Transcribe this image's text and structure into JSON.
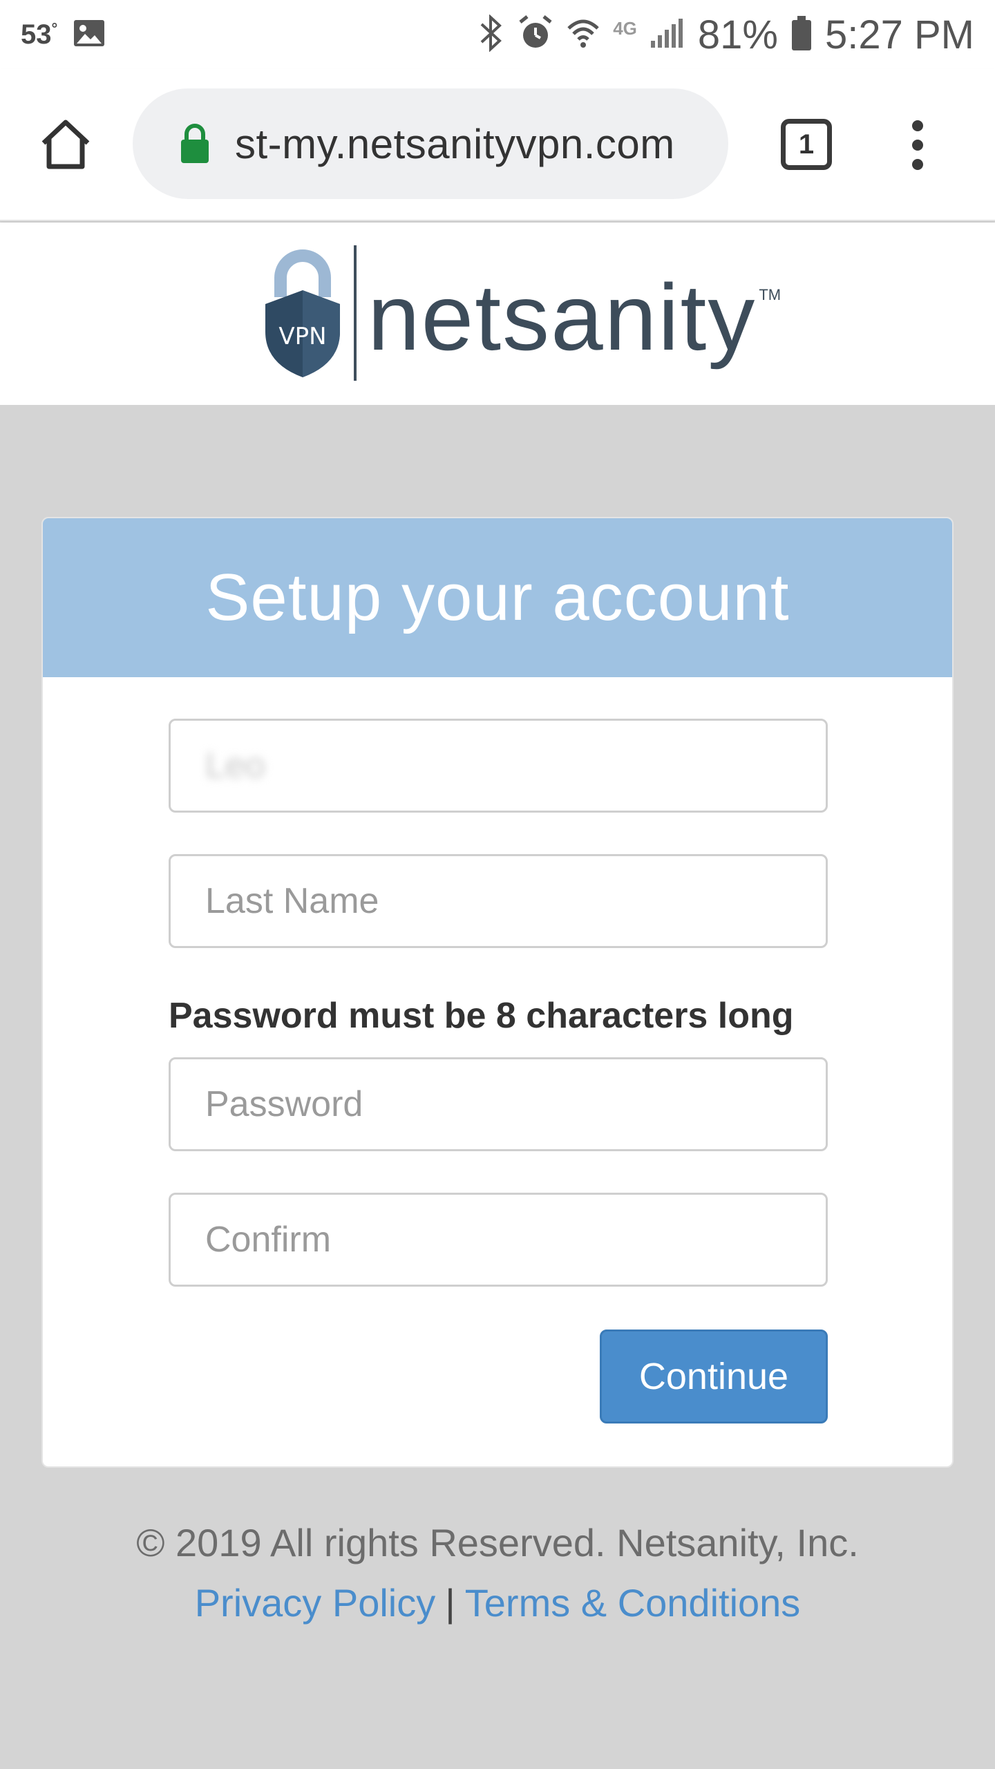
{
  "status_bar": {
    "temperature": "53",
    "temperature_unit": "°",
    "network": "4G",
    "battery": "81%",
    "time": "5:27 PM"
  },
  "browser": {
    "url": "st-my.netsanityvpn.com",
    "tab_count": "1"
  },
  "brand": {
    "logo_badge": "VPN",
    "name": "netsanity",
    "trademark": "TM"
  },
  "form": {
    "title": "Setup your account",
    "first_name_value": "Leo",
    "last_name_placeholder": "Last Name",
    "password_hint": "Password must be 8 characters long",
    "password_placeholder": "Password",
    "confirm_placeholder": "Confirm",
    "continue_label": "Continue"
  },
  "footer": {
    "copyright": "© 2019 All rights Reserved. Netsanity, Inc.",
    "privacy_link": "Privacy Policy",
    "separator": "|",
    "terms_link": "Terms & Conditions"
  },
  "colors": {
    "header_blue": "#9fc2e2",
    "button_blue": "#4a8dcc",
    "link_blue": "#4a8dcc",
    "page_gray": "#d4d4d4",
    "brand_slate": "#3d4c5a"
  }
}
